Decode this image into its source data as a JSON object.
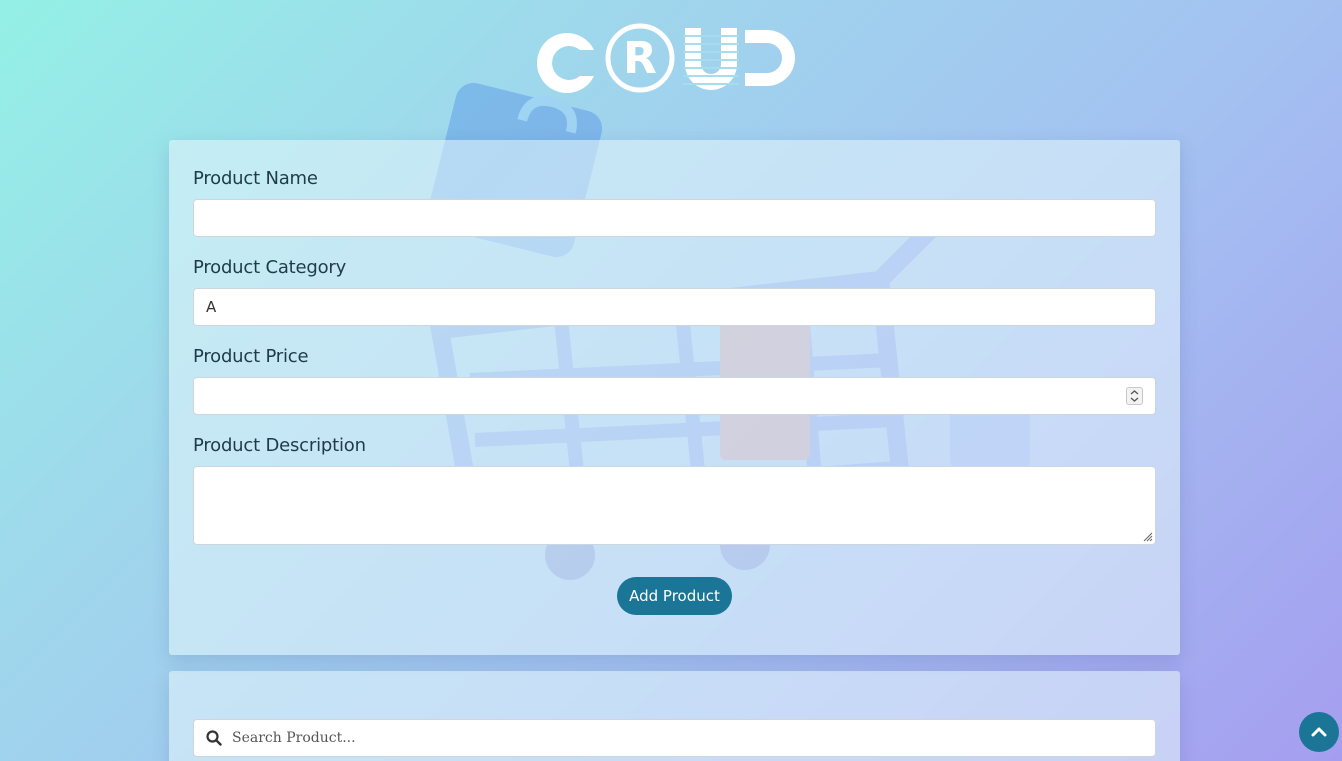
{
  "logo": {
    "text": "CRUD"
  },
  "form": {
    "name_label": "Product Name",
    "name_value": "",
    "category_label": "Product Category",
    "category_value": "A",
    "price_label": "Product Price",
    "price_value": "",
    "description_label": "Product Description",
    "description_value": "",
    "submit_label": "Add Product"
  },
  "search": {
    "placeholder": "Search Product...",
    "icon": "search-icon"
  },
  "scroll_top": {
    "icon": "chevron-up-icon"
  },
  "colors": {
    "primary": "#1a7596",
    "label": "#1f3b4a"
  }
}
